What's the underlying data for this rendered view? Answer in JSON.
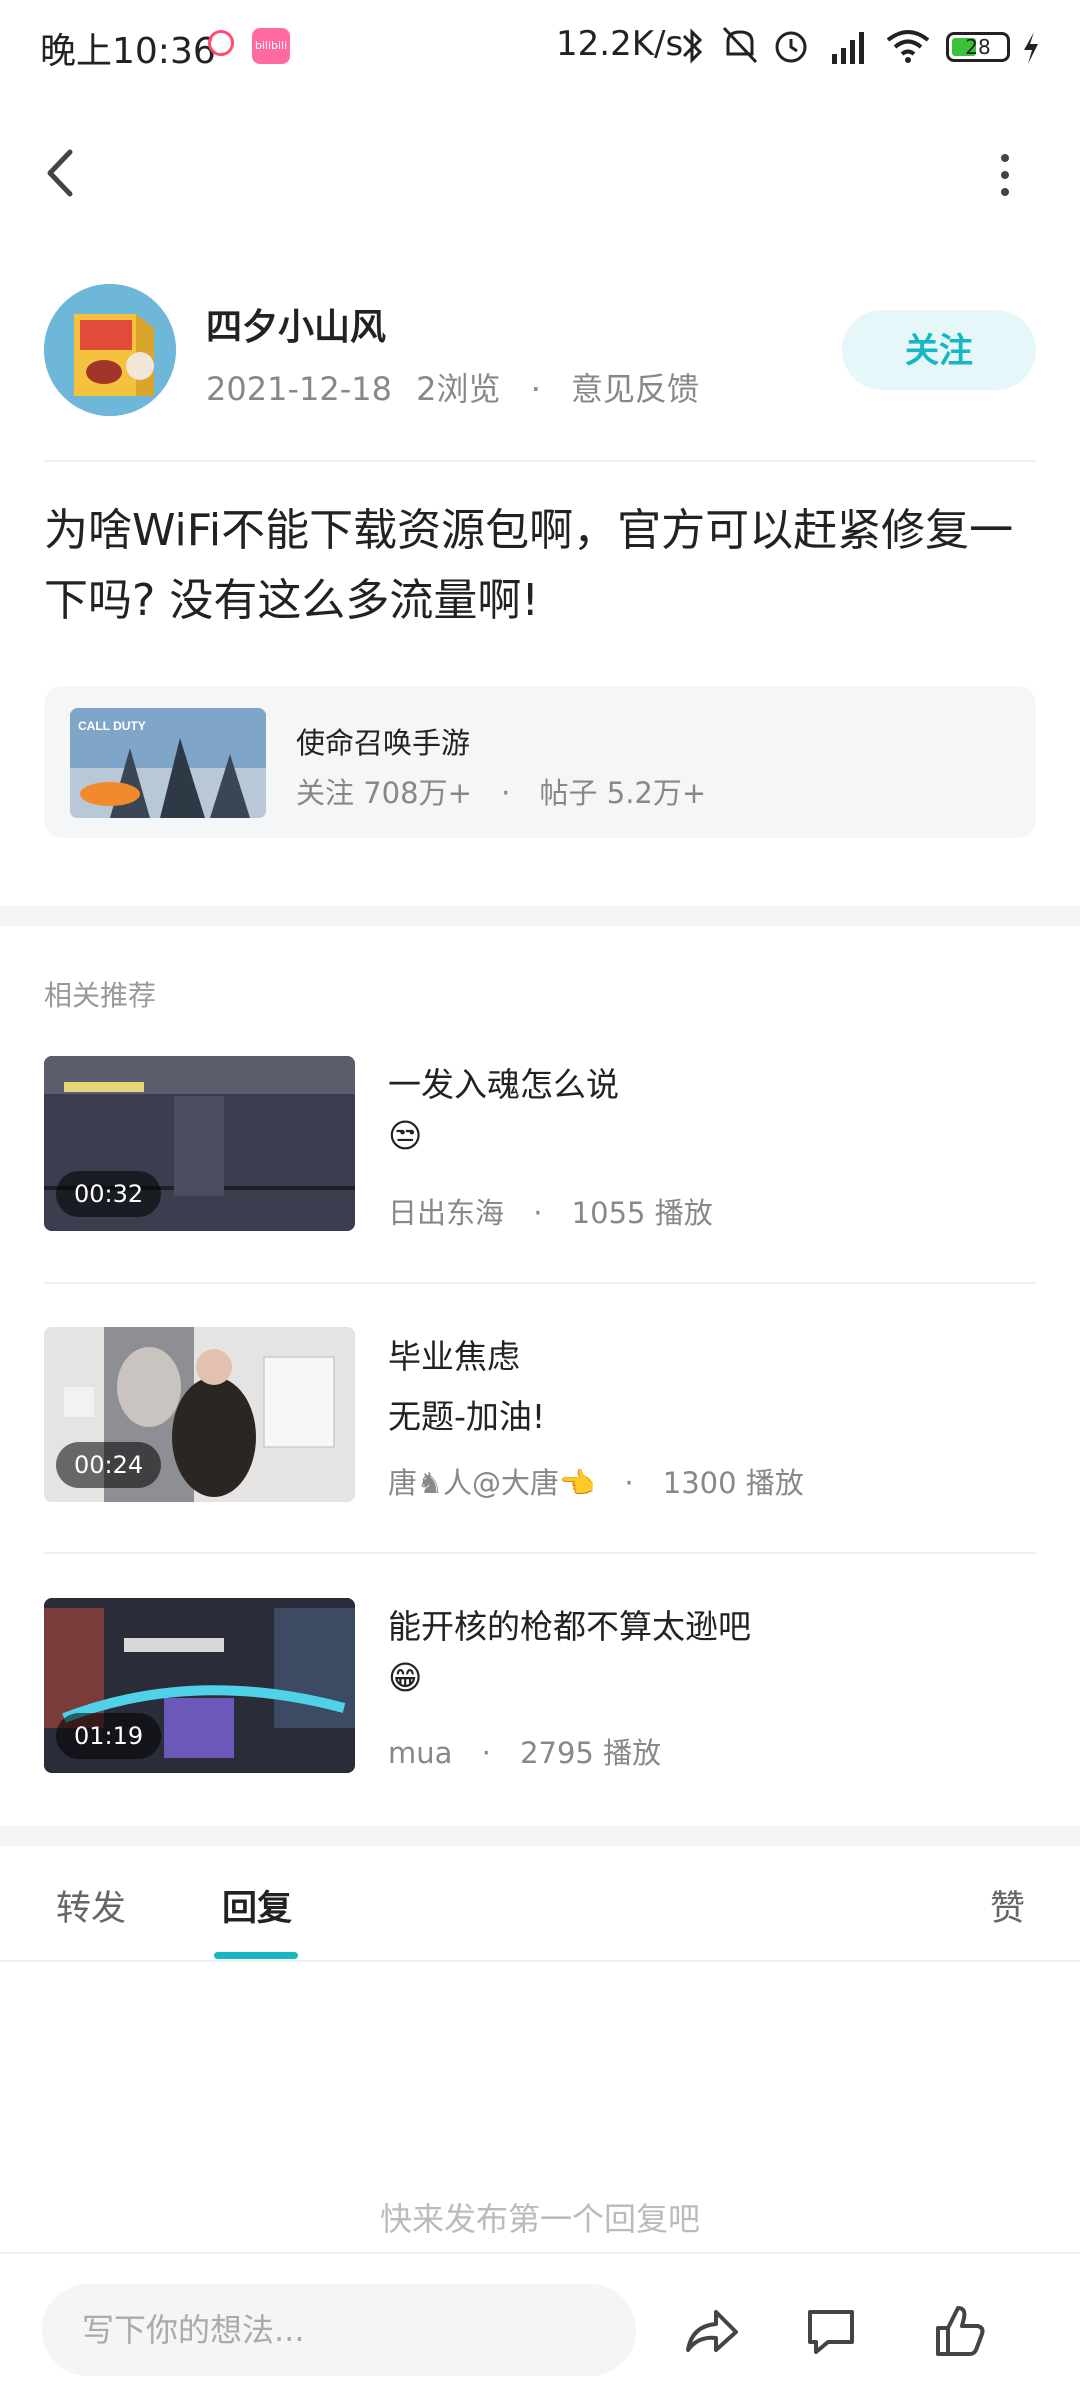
{
  "status_bar": {
    "time": "晚上10:36",
    "app_badge": "bilibili",
    "net_speed": "12.2K/s",
    "battery": "28"
  },
  "author": {
    "name": "四夕小山风",
    "date": "2021-12-18",
    "views": "2浏览",
    "separator": "·",
    "feedback": "意见反馈",
    "follow_label": "关注"
  },
  "post": {
    "text": "为啥WiFi不能下载资源包啊，官方可以赶紧修复一下吗? 没有这么多流量啊!"
  },
  "topic": {
    "name": "使命召唤手游",
    "thumb_label": "CALL DUTY",
    "followers_label": "关注 708万+",
    "separator": "·",
    "posts_label": "帖子 5.2万+"
  },
  "recommend": {
    "section_title": "相关推荐",
    "items": [
      {
        "title": "一发入魂怎么说",
        "subtitle": "😒",
        "duration": "00:32",
        "author": "日出东海",
        "separator": "·",
        "plays": "1055 播放"
      },
      {
        "title": "毕业焦虑",
        "subtitle": "无题-加油!",
        "duration": "00:24",
        "author": "唐♞人@大唐👈",
        "separator": "·",
        "plays": "1300 播放"
      },
      {
        "title": "能开核的枪都不算太逊吧",
        "subtitle": "😁",
        "duration": "01:19",
        "author": "mua",
        "separator": "·",
        "plays": "2795 播放"
      }
    ]
  },
  "tabs": {
    "forward": "转发",
    "reply": "回复",
    "like": "赞",
    "active": "reply"
  },
  "empty_state": "快来发布第一个回复吧",
  "bottom_bar": {
    "input_placeholder": "写下你的想法..."
  },
  "colors": {
    "accent": "#17b6c3",
    "follow_bg": "#e5f7f8",
    "secondary_text": "#888888"
  }
}
